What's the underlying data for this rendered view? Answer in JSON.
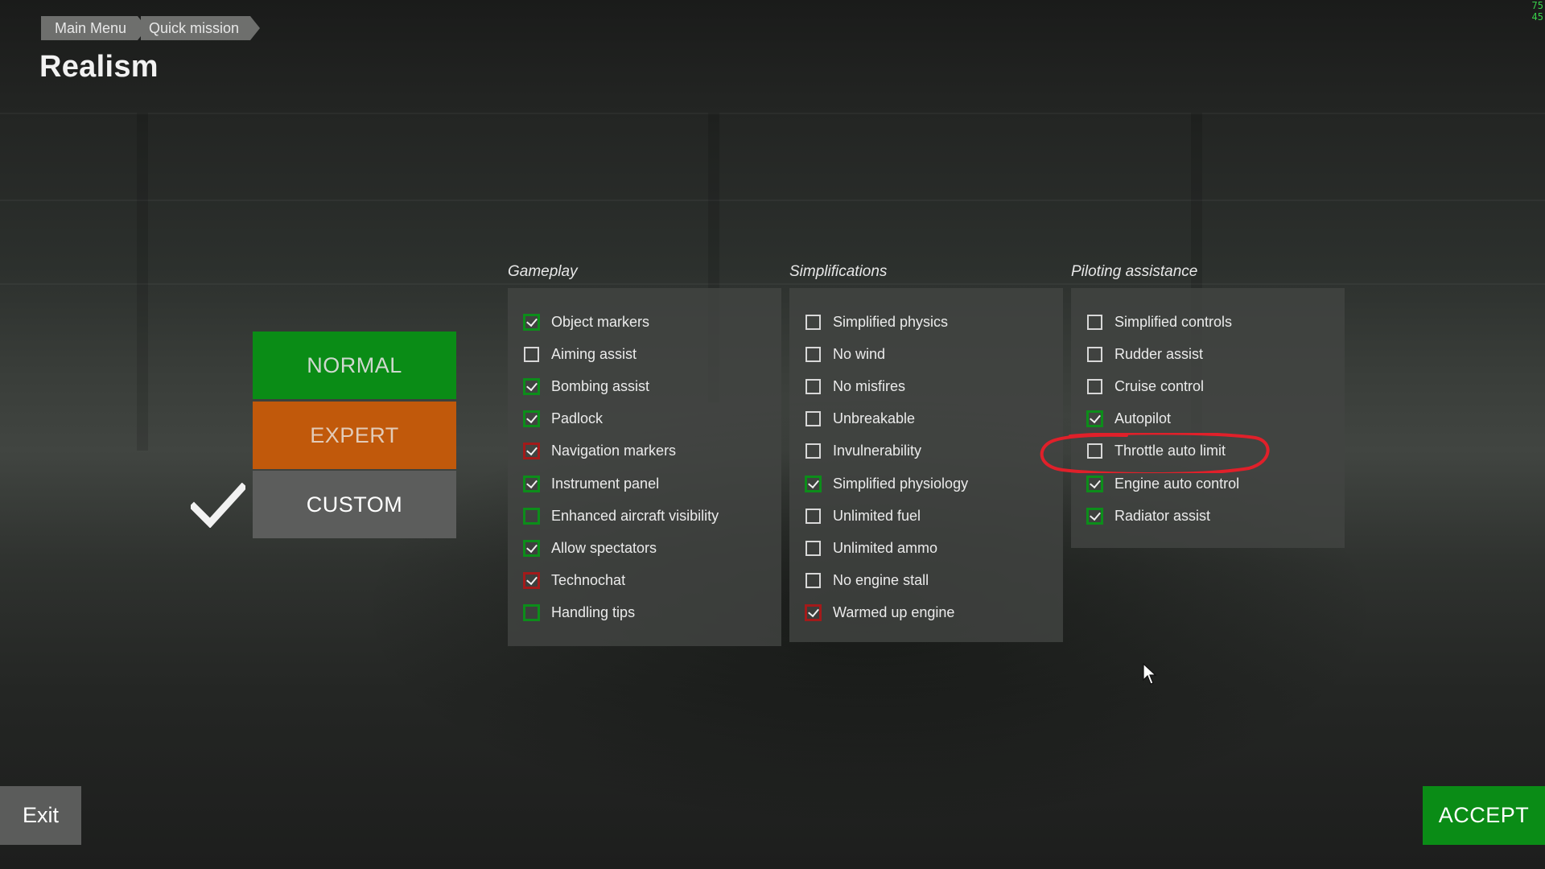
{
  "breadcrumb": [
    "Main Menu",
    "Quick mission"
  ],
  "title": "Realism",
  "fps_overlay": "75\n45",
  "presets": {
    "normal": "NORMAL",
    "expert": "EXPERT",
    "custom": "CUSTOM",
    "selected": "custom"
  },
  "columns": {
    "gameplay": {
      "label": "Gameplay",
      "options": [
        {
          "label": "Object markers",
          "checked": true,
          "tint": "green"
        },
        {
          "label": "Aiming assist",
          "checked": false,
          "tint": "none"
        },
        {
          "label": "Bombing assist",
          "checked": true,
          "tint": "green"
        },
        {
          "label": "Padlock",
          "checked": true,
          "tint": "green"
        },
        {
          "label": "Navigation markers",
          "checked": true,
          "tint": "red"
        },
        {
          "label": "Instrument panel",
          "checked": true,
          "tint": "green"
        },
        {
          "label": "Enhanced aircraft visibility",
          "checked": false,
          "tint": "green"
        },
        {
          "label": "Allow spectators",
          "checked": true,
          "tint": "green"
        },
        {
          "label": "Technochat",
          "checked": true,
          "tint": "red"
        },
        {
          "label": "Handling tips",
          "checked": false,
          "tint": "green"
        }
      ]
    },
    "simplifications": {
      "label": "Simplifications",
      "options": [
        {
          "label": "Simplified physics",
          "checked": false,
          "tint": "none"
        },
        {
          "label": "No wind",
          "checked": false,
          "tint": "none"
        },
        {
          "label": "No misfires",
          "checked": false,
          "tint": "none"
        },
        {
          "label": "Unbreakable",
          "checked": false,
          "tint": "none"
        },
        {
          "label": "Invulnerability",
          "checked": false,
          "tint": "none"
        },
        {
          "label": "Simplified physiology",
          "checked": true,
          "tint": "none"
        },
        {
          "label": "Unlimited fuel",
          "checked": false,
          "tint": "none"
        },
        {
          "label": "Unlimited ammo",
          "checked": false,
          "tint": "none"
        },
        {
          "label": "No engine stall",
          "checked": false,
          "tint": "none"
        },
        {
          "label": "Warmed up engine",
          "checked": true,
          "tint": "red"
        }
      ]
    },
    "piloting": {
      "label": "Piloting assistance",
      "options": [
        {
          "label": "Simplified controls",
          "checked": false,
          "tint": "none"
        },
        {
          "label": "Rudder assist",
          "checked": false,
          "tint": "none"
        },
        {
          "label": "Cruise control",
          "checked": false,
          "tint": "none"
        },
        {
          "label": "Autopilot",
          "checked": true,
          "tint": "green"
        },
        {
          "label": "Throttle auto limit",
          "checked": false,
          "tint": "none"
        },
        {
          "label": "Engine auto control",
          "checked": true,
          "tint": "green"
        },
        {
          "label": "Radiator assist",
          "checked": true,
          "tint": "green"
        }
      ]
    }
  },
  "buttons": {
    "exit": "Exit",
    "accept": "ACCEPT"
  },
  "colors": {
    "accent_green": "#0a8c16",
    "expert_orange": "#c1590b",
    "annotation_red": "#e0202a"
  }
}
